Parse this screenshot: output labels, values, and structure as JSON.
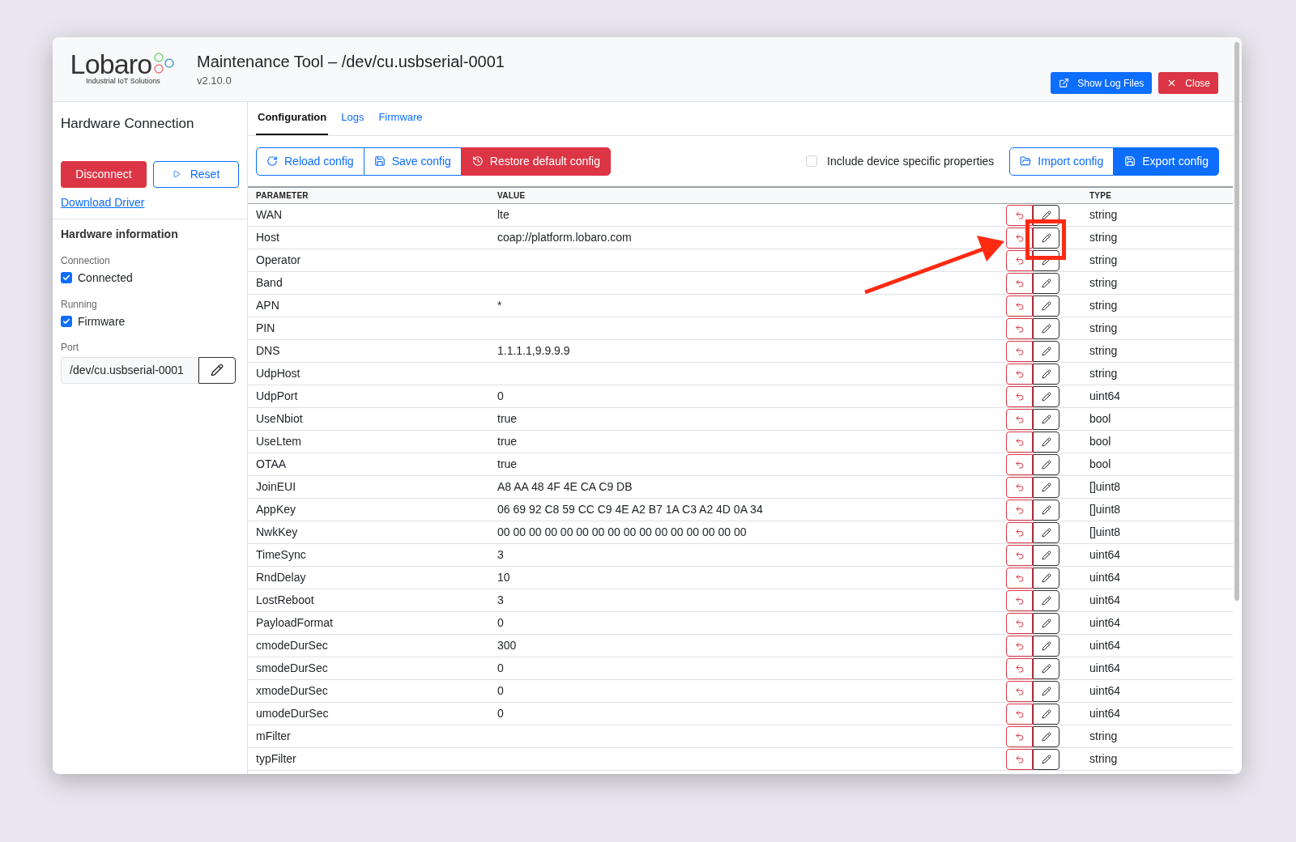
{
  "header": {
    "logo_text": "Lobaro",
    "logo_tagline": "Industrial IoT Solutions",
    "title": "Maintenance Tool – /dev/cu.usbserial-0001",
    "version": "v2.10.0",
    "buttons": [
      {
        "kind": "log",
        "label": "Show Log Files"
      },
      {
        "kind": "close",
        "label": "Close"
      }
    ]
  },
  "sidebar": {
    "title": "Hardware Connection",
    "disconnect": "Disconnect",
    "reset": "Reset",
    "download_link": "Download Driver",
    "info_title": "Hardware information",
    "checks": [
      {
        "caption": "Connection",
        "label": "Connected",
        "checked": true
      },
      {
        "caption": "Running",
        "label": "Firmware",
        "checked": true
      }
    ],
    "port": {
      "caption": "Port",
      "value": "/dev/cu.usbserial-0001"
    }
  },
  "tabs": [
    {
      "label": "Configuration",
      "selected": true
    },
    {
      "label": "Logs",
      "selected": false
    },
    {
      "label": "Firmware",
      "selected": false
    }
  ],
  "toolbar": {
    "buttons": [
      {
        "kind": "reload",
        "label": "Reload config"
      },
      {
        "kind": "save",
        "label": "Save config"
      },
      {
        "kind": "restore",
        "label": "Restore default config"
      }
    ],
    "include_device": {
      "label": "Include device specific properties",
      "checked": false
    },
    "right_buttons": [
      {
        "kind": "import",
        "label": "Import config"
      },
      {
        "kind": "export",
        "label": "Export config"
      }
    ]
  },
  "table": {
    "columns": [
      "PARAMETER",
      "VALUE",
      "TYPE"
    ],
    "rows": [
      {
        "parameter": "WAN",
        "value": "lte",
        "type": "string"
      },
      {
        "parameter": "Host",
        "value": "coap://platform.lobaro.com",
        "type": "string"
      },
      {
        "parameter": "Operator",
        "value": "",
        "type": "string"
      },
      {
        "parameter": "Band",
        "value": "",
        "type": "string"
      },
      {
        "parameter": "APN",
        "value": "*",
        "type": "string"
      },
      {
        "parameter": "PIN",
        "value": "",
        "type": "string"
      },
      {
        "parameter": "DNS",
        "value": "1.1.1.1,9.9.9.9",
        "type": "string"
      },
      {
        "parameter": "UdpHost",
        "value": "",
        "type": "string"
      },
      {
        "parameter": "UdpPort",
        "value": "0",
        "type": "uint64"
      },
      {
        "parameter": "UseNbiot",
        "value": "true",
        "type": "bool"
      },
      {
        "parameter": "UseLtem",
        "value": "true",
        "type": "bool"
      },
      {
        "parameter": "OTAA",
        "value": "true",
        "type": "bool"
      },
      {
        "parameter": "JoinEUI",
        "value": "A8 AA 48 4F 4E CA C9 DB",
        "type": "[]uint8"
      },
      {
        "parameter": "AppKey",
        "value": "06 69 92 C8 59 CC C9 4E A2 B7 1A C3 A2 4D 0A 34",
        "type": "[]uint8"
      },
      {
        "parameter": "NwkKey",
        "value": "00 00 00 00 00 00 00 00 00 00 00 00 00 00 00 00",
        "type": "[]uint8"
      },
      {
        "parameter": "TimeSync",
        "value": "3",
        "type": "uint64"
      },
      {
        "parameter": "RndDelay",
        "value": "10",
        "type": "uint64"
      },
      {
        "parameter": "LostReboot",
        "value": "3",
        "type": "uint64"
      },
      {
        "parameter": "PayloadFormat",
        "value": "0",
        "type": "uint64"
      },
      {
        "parameter": "cmodeDurSec",
        "value": "300",
        "type": "uint64"
      },
      {
        "parameter": "smodeDurSec",
        "value": "0",
        "type": "uint64"
      },
      {
        "parameter": "xmodeDurSec",
        "value": "0",
        "type": "uint64"
      },
      {
        "parameter": "umodeDurSec",
        "value": "0",
        "type": "uint64"
      },
      {
        "parameter": "mFilter",
        "value": "",
        "type": "string"
      },
      {
        "parameter": "typFilter",
        "value": "",
        "type": "string"
      }
    ]
  }
}
